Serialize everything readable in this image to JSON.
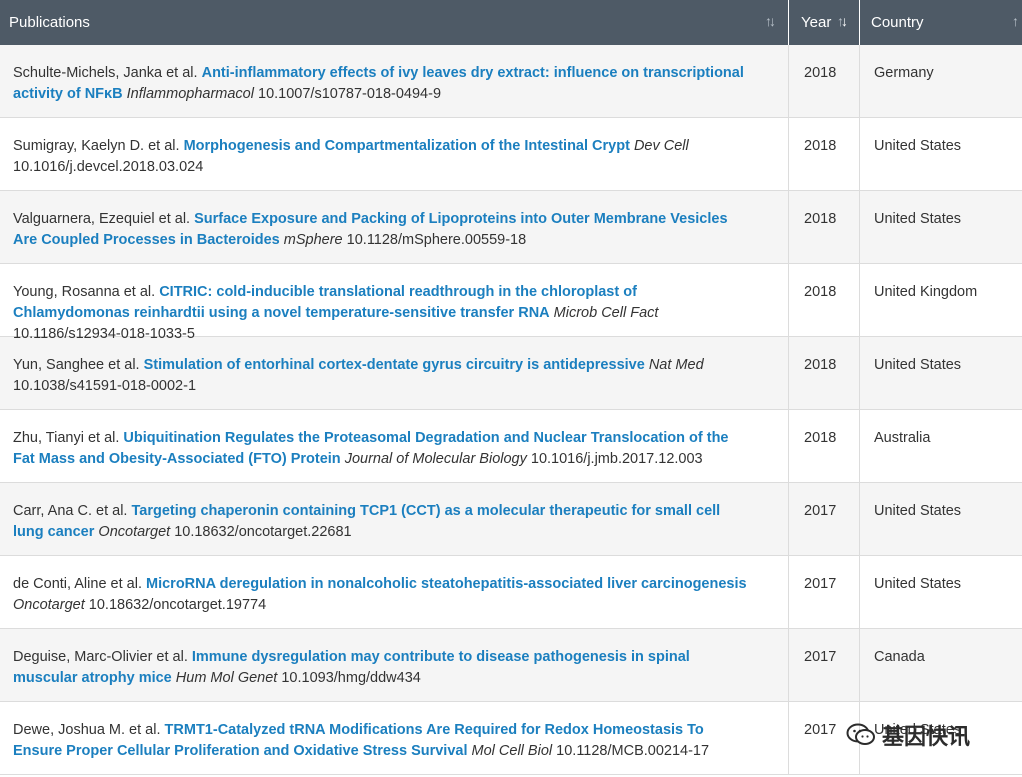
{
  "header": {
    "publications": "Publications",
    "year": "Year",
    "country": "Country"
  },
  "rows": [
    {
      "authors": "Schulte-Michels, Janka et al.",
      "title": "Anti-inflammatory effects of ivy leaves dry extract: influence on transcriptional activity of NFκB",
      "journal": "Inflammopharmacol",
      "doi": "10.1007/s10787-018-0494-9",
      "year": "2018",
      "country": "Germany"
    },
    {
      "authors": "Sumigray, Kaelyn D. et al.",
      "title": "Morphogenesis and Compartmentalization of the Intestinal Crypt",
      "journal": "Dev Cell",
      "doi": "10.1016/j.devcel.2018.03.024",
      "year": "2018",
      "country": "United States"
    },
    {
      "authors": "Valguarnera, Ezequiel et al.",
      "title": "Surface Exposure and Packing of Lipoproteins into Outer Membrane Vesicles Are Coupled Processes in Bacteroides",
      "journal": "mSphere",
      "doi": "10.1128/mSphere.00559-18",
      "year": "2018",
      "country": "United States"
    },
    {
      "authors": "Young, Rosanna et al.",
      "title": "CITRIC: cold-inducible translational readthrough in the chloroplast of Chlamydomonas reinhardtii using a novel temperature-sensitive transfer RNA",
      "journal": "Microb Cell Fact",
      "doi": "10.1186/s12934-018-1033-5",
      "year": "2018",
      "country": "United Kingdom"
    },
    {
      "authors": "Yun, Sanghee et al.",
      "title": "Stimulation of entorhinal cortex-dentate gyrus circuitry is antidepressive",
      "journal": "Nat Med",
      "doi": "10.1038/s41591-018-0002-1",
      "year": "2018",
      "country": "United States"
    },
    {
      "authors": "Zhu, Tianyi et al.",
      "title": "Ubiquitination Regulates the Proteasomal Degradation and Nuclear Translocation of the Fat Mass and Obesity-Associated (FTO) Protein",
      "journal": "Journal of Molecular Biology",
      "doi": "10.1016/j.jmb.2017.12.003",
      "year": "2018",
      "country": "Australia"
    },
    {
      "authors": "Carr, Ana C. et al.",
      "title": "Targeting chaperonin containing TCP1 (CCT) as a molecular therapeutic for small cell lung cancer",
      "journal": "Oncotarget",
      "doi": "10.18632/oncotarget.22681",
      "year": "2017",
      "country": "United States"
    },
    {
      "authors": "de Conti, Aline et al.",
      "title": "MicroRNA deregulation in nonalcoholic steatohepatitis-associated liver carcinogenesis",
      "journal": "Oncotarget",
      "doi": "10.18632/oncotarget.19774",
      "year": "2017",
      "country": "United States"
    },
    {
      "authors": "Deguise, Marc-Olivier et al.",
      "title": "Immune dysregulation may contribute to disease pathogenesis in spinal muscular atrophy mice",
      "journal": "Hum Mol Genet",
      "doi": "10.1093/hmg/ddw434",
      "year": "2017",
      "country": "Canada"
    },
    {
      "authors": "Dewe, Joshua M. et al.",
      "title": "TRMT1-Catalyzed tRNA Modifications Are Required for Redox Homeostasis To Ensure Proper Cellular Proliferation and Oxidative Stress Survival",
      "journal": "Mol Cell Biol",
      "doi": "10.1128/MCB.00214-17",
      "year": "2017",
      "country": "United States"
    }
  ],
  "watermark": {
    "text": "基因快讯",
    "icon": "wechat-icon"
  },
  "colors": {
    "header_bg": "#4e5a66",
    "link": "#1b7fbf",
    "row_alt": "#f5f5f5"
  }
}
